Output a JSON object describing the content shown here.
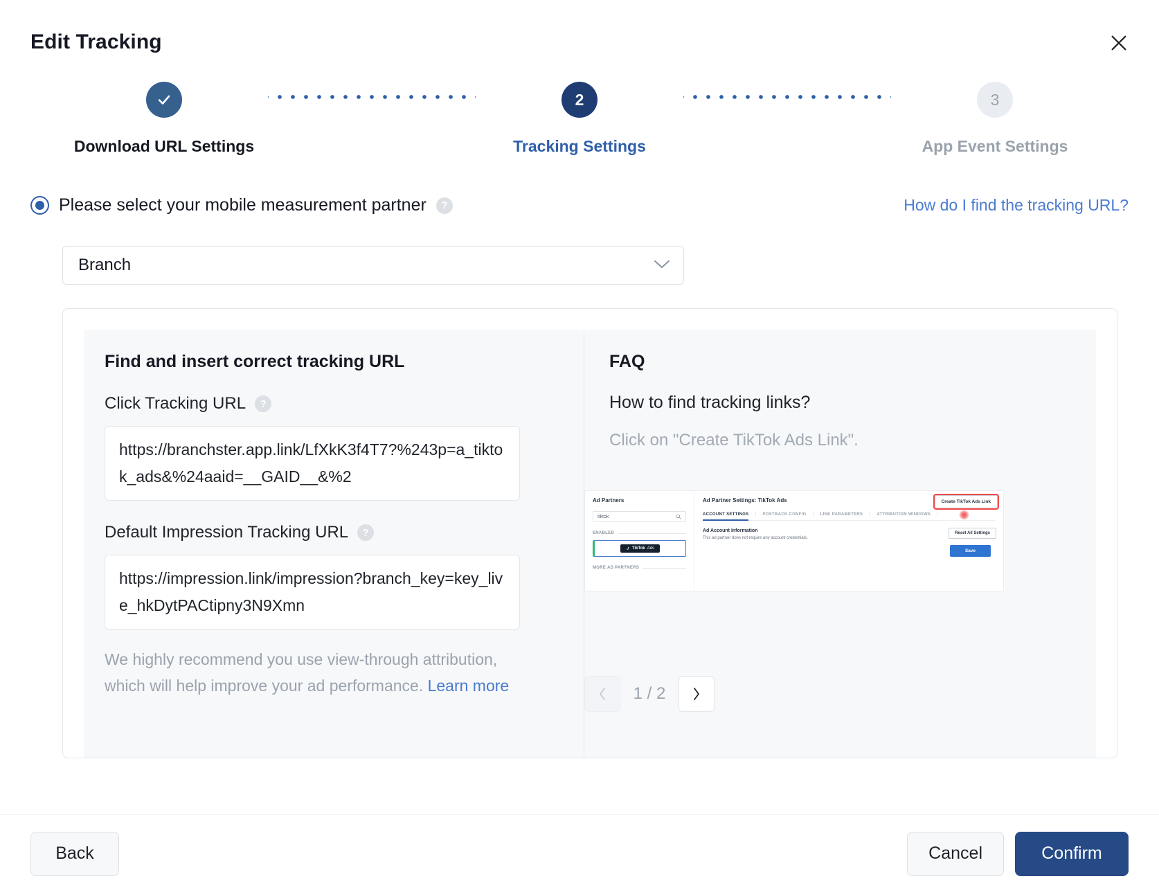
{
  "header": {
    "title": "Edit Tracking",
    "close_icon": "close-icon"
  },
  "stepper": {
    "steps": [
      {
        "indicator": "✓",
        "label": "Download URL Settings",
        "state": "done"
      },
      {
        "indicator": "2",
        "label": "Tracking Settings",
        "state": "active"
      },
      {
        "indicator": "3",
        "label": "App Event Settings",
        "state": "todo"
      }
    ]
  },
  "mmp": {
    "radio_label": "Please select your mobile measurement partner",
    "help_icon": "question-mark-icon",
    "help_link": "How do I find the tracking URL?",
    "select_value": "Branch",
    "chevron_icon": "chevron-down-icon"
  },
  "tracking_panel": {
    "heading": "Find and insert correct tracking URL",
    "click_url": {
      "label": "Click Tracking URL",
      "help_icon": "question-mark-icon",
      "value": "https://branchster.app.link/LfXkK3f4T7?%243p=a_tiktok_ads&%24aaid=__GAID__&%2"
    },
    "impression_url": {
      "label": "Default Impression Tracking URL",
      "help_icon": "question-mark-icon",
      "value": "https://impression.link/impression?branch_key=key_live_hkDytPACtipny3N9Xmn"
    },
    "note_text": "We highly recommend you use view-through attribution, which will help improve your ad performance. ",
    "note_link": "Learn more"
  },
  "faq": {
    "heading": "FAQ",
    "question": "How to find tracking links?",
    "answer": "Click on \"Create TikTok Ads Link\".",
    "screenshot": {
      "left_heading": "Ad Partners",
      "search_value": "tiktok",
      "search_icon": "search-icon",
      "enabled_label": "ENABLED",
      "partner_chip": "TikTok",
      "partner_chip_sub": "Ads",
      "more_partners_label": "MORE AD PARTNERS",
      "right_heading": "Ad Partner Settings: TikTok Ads",
      "tabs": [
        "ACCOUNT SETTINGS",
        "POSTBACK CONFIG",
        "LINK PARAMETERS",
        "ATTRIBUTION WINDOWS"
      ],
      "info_heading": "Ad Account Information",
      "info_text": "This ad partner does not require any account credentials.",
      "create_button": "Create TikTok Ads Link",
      "reset_button": "Reset All Settings",
      "save_button": "Save",
      "highlight_color": "#f24a4a"
    },
    "pagination": {
      "prev_icon": "chevron-left-icon",
      "next_icon": "chevron-right-icon",
      "count": "1 / 2"
    }
  },
  "footer": {
    "back": "Back",
    "cancel": "Cancel",
    "confirm": "Confirm"
  }
}
